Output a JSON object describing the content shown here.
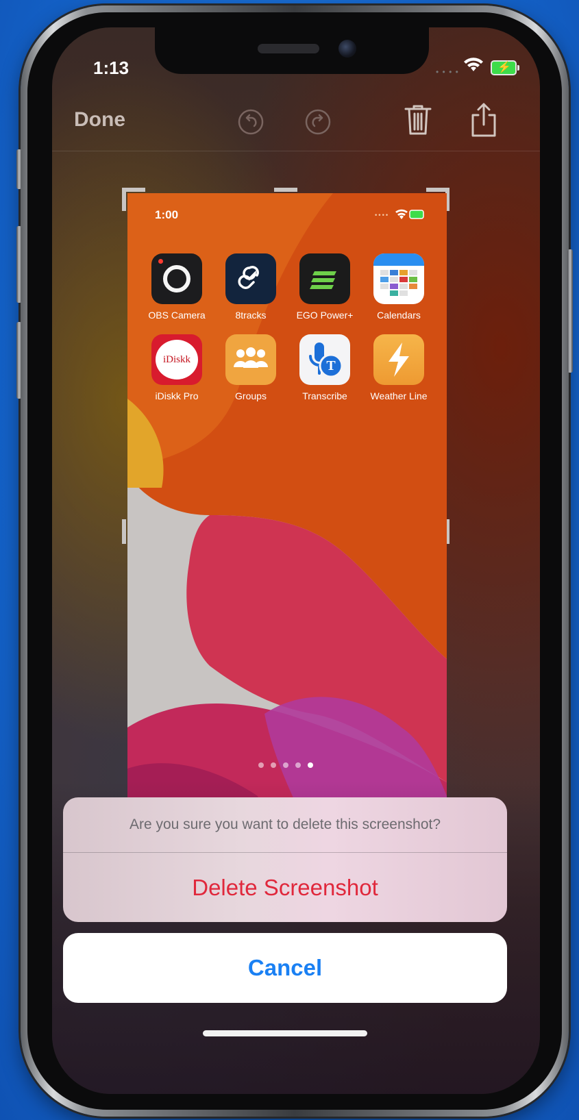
{
  "status_bar": {
    "time": "1:13"
  },
  "toolbar": {
    "done_label": "Done",
    "undo_icon": "undo-icon",
    "redo_icon": "redo-icon",
    "trash_icon": "trash-icon",
    "share_icon": "share-icon"
  },
  "preview": {
    "time": "1:00",
    "apps": [
      {
        "name": "OBS Camera",
        "icon": "obs-camera-icon"
      },
      {
        "name": "8tracks",
        "icon": "8tracks-icon"
      },
      {
        "name": "EGO Power+",
        "icon": "ego-power-icon"
      },
      {
        "name": "Calendars",
        "icon": "calendars-icon"
      },
      {
        "name": "iDiskk Pro",
        "icon": "idiskk-pro-icon",
        "tile_text": "iDiskk"
      },
      {
        "name": "Groups",
        "icon": "groups-icon"
      },
      {
        "name": "Transcribe",
        "icon": "transcribe-icon",
        "tile_text": "T"
      },
      {
        "name": "Weather Line",
        "icon": "weather-line-icon"
      }
    ],
    "page_count": 5,
    "current_page": 5
  },
  "action_sheet": {
    "message": "Are you sure you want to delete this screenshot?",
    "delete_label": "Delete Screenshot",
    "cancel_label": "Cancel"
  },
  "colors": {
    "destructive": "#e0283c",
    "cancel_text": "#1a80f3",
    "background_blue": "#1668d0"
  }
}
